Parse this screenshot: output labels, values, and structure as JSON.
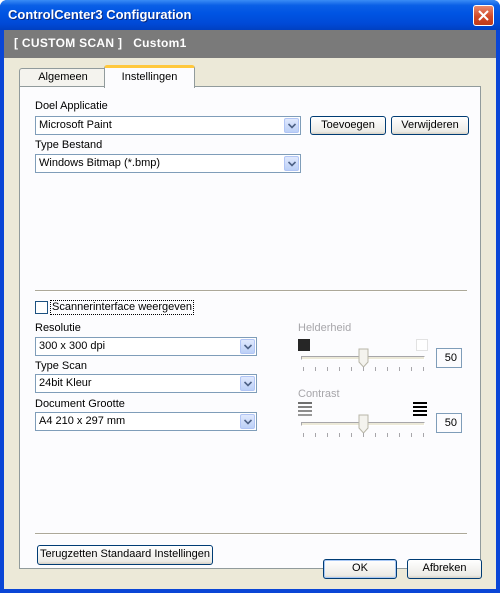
{
  "window": {
    "title": "ControlCenter3 Configuration"
  },
  "header": {
    "mode": "[ CUSTOM SCAN ]",
    "name": "Custom1"
  },
  "tabs": [
    {
      "label": "Algemeen",
      "active": false
    },
    {
      "label": "Instellingen",
      "active": true
    }
  ],
  "doel": {
    "label": "Doel Applicatie",
    "value": "Microsoft Paint",
    "add_label": "Toevoegen",
    "remove_label": "Verwijderen"
  },
  "bestand": {
    "label": "Type Bestand",
    "value": "Windows Bitmap (*.bmp)"
  },
  "scanner_interface": {
    "label": "Scannerinterface weergeven",
    "checked": false
  },
  "resolutie": {
    "label": "Resolutie",
    "value": "300 x 300 dpi"
  },
  "type_scan": {
    "label": "Type Scan",
    "value": "24bit Kleur"
  },
  "document": {
    "label": "Document Grootte",
    "value": "A4 210 x 297 mm"
  },
  "helderheid": {
    "label": "Helderheid",
    "value": "50"
  },
  "contrast": {
    "label": "Contrast",
    "value": "50"
  },
  "reset": {
    "label": "Terugzetten Standaard Instellingen"
  },
  "footer": {
    "ok_label": "OK",
    "cancel_label": "Afbreken"
  },
  "colors": {
    "titlebar": "#0054e3",
    "header_band": "#7a7a7a",
    "dialog_bg": "#ece9d8",
    "tab_highlight": "#ffc83c"
  }
}
